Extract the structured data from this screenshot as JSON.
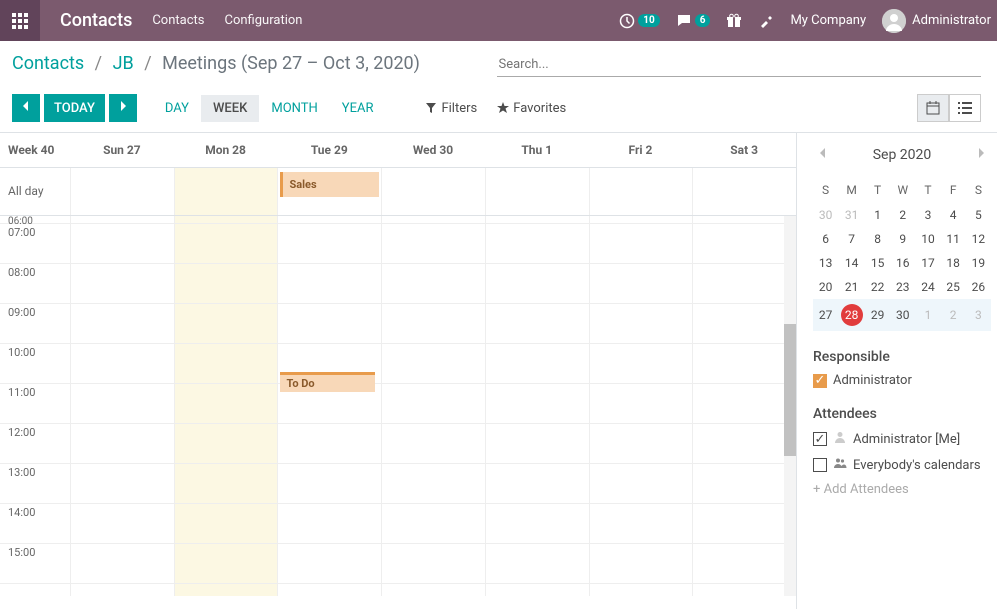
{
  "topnav": {
    "brand": "Contacts",
    "links": [
      "Contacts",
      "Configuration"
    ],
    "clock_badge": "10",
    "chat_badge": "6",
    "company": "My Company",
    "user": "Administrator"
  },
  "breadcrumb": {
    "root": "Contacts",
    "mid": "JB",
    "leaf": "Meetings (Sep 27 – Oct 3, 2020)"
  },
  "search": {
    "placeholder": "Search..."
  },
  "toolbar": {
    "today": "TODAY",
    "scales": {
      "day": "DAY",
      "week": "WEEK",
      "month": "MONTH",
      "year": "YEAR"
    },
    "filters": "Filters",
    "favorites": "Favorites"
  },
  "calendar": {
    "week_label": "Week 40",
    "days": [
      "Sun 27",
      "Mon 28",
      "Tue 29",
      "Wed 30",
      "Thu 1",
      "Fri 2",
      "Sat 3"
    ],
    "allday_label": "All day",
    "hours": [
      "06:00",
      "07:00",
      "08:00",
      "09:00",
      "10:00",
      "11:00",
      "12:00",
      "13:00",
      "14:00",
      "15:00"
    ],
    "events": {
      "allday_tue": "Sales",
      "timed_tue": "To Do"
    }
  },
  "minical": {
    "title": "Sep 2020",
    "dow": [
      "S",
      "M",
      "T",
      "W",
      "T",
      "F",
      "S"
    ],
    "rows": [
      [
        "30",
        "31",
        "1",
        "2",
        "3",
        "4",
        "5"
      ],
      [
        "6",
        "7",
        "8",
        "9",
        "10",
        "11",
        "12"
      ],
      [
        "13",
        "14",
        "15",
        "16",
        "17",
        "18",
        "19"
      ],
      [
        "20",
        "21",
        "22",
        "23",
        "24",
        "25",
        "26"
      ],
      [
        "27",
        "28",
        "29",
        "30",
        "1",
        "2",
        "3"
      ]
    ]
  },
  "sidebar": {
    "responsible": {
      "title": "Responsible",
      "item": "Administrator"
    },
    "attendees": {
      "title": "Attendees",
      "me": "Administrator [Me]",
      "everybody": "Everybody's calendars",
      "add": "+ Add Attendees"
    }
  }
}
